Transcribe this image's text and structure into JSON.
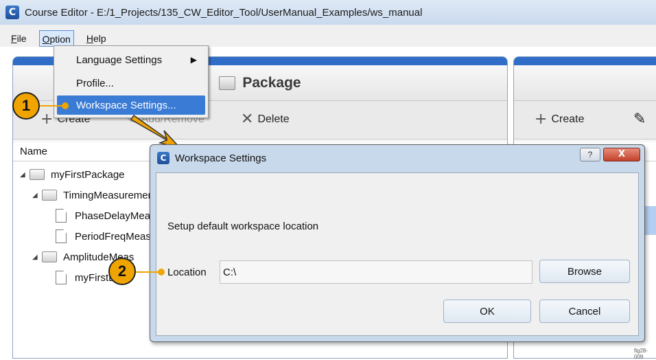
{
  "window": {
    "title": "Course Editor - E:/1_Projects/135_CW_Editor_Tool/UserManual_Examples/ws_manual",
    "icon": "app-c-icon"
  },
  "menubar": {
    "items": [
      {
        "label": "File",
        "key": "F",
        "rest": "ile"
      },
      {
        "label": "Option",
        "key": "O",
        "rest": "ption"
      },
      {
        "label": "Help",
        "key": "H",
        "rest": "elp"
      }
    ]
  },
  "option_menu": {
    "items": [
      "Language Settings",
      "Profile...",
      "Workspace Settings..."
    ],
    "submenu_arrow": "▶"
  },
  "package_panel": {
    "title": "Package",
    "toolbar": {
      "create": "Create",
      "add_remove": "Add/Remove",
      "delete": "Delete"
    },
    "column_name": "Name",
    "tree": [
      {
        "label": "myFirstPackage",
        "type": "folder",
        "expanded": true
      },
      {
        "label": "TimingMeasurements",
        "type": "folder",
        "expanded": true
      },
      {
        "label": "PhaseDelayMeas",
        "type": "file"
      },
      {
        "label": "PeriodFreqMeas",
        "type": "file"
      },
      {
        "label": "AmplitudeMeas",
        "type": "folder",
        "expanded": true
      },
      {
        "label": "myFirstLab",
        "type": "file"
      }
    ]
  },
  "right_panel": {
    "toolbar": {
      "create": "Create"
    }
  },
  "dialog": {
    "title": "Workspace Settings",
    "help": "?",
    "close": "X",
    "description": "Setup default workspace location",
    "location_label": "Location",
    "location_value": "C:\\",
    "browse": "Browse",
    "ok": "OK",
    "cancel": "Cancel"
  },
  "callouts": {
    "one": "1",
    "two": "2"
  },
  "figure_label": "fig28-009",
  "colors": {
    "accent": "#3a7bd5",
    "callout": "#f0a400",
    "panel_header_bar": "#2f6dc7"
  }
}
